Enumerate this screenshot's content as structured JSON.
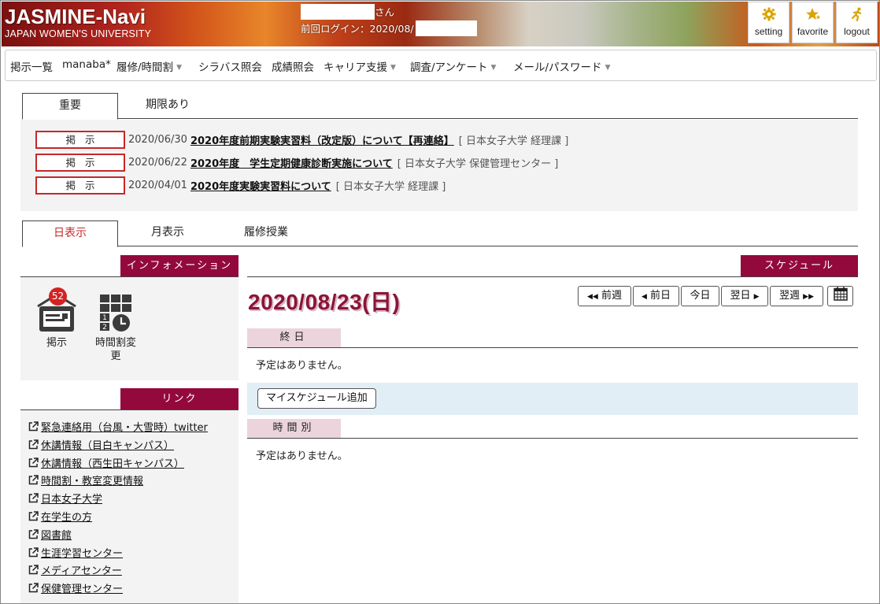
{
  "header": {
    "logo_title": "JASMINE-Navi",
    "logo_subtitle": "JAPAN WOMEN'S UNIVERSITY",
    "user_suffix": "さん",
    "last_login_label": "前回ログイン：2020/08/",
    "buttons": [
      {
        "label": "setting",
        "icon": "gear-icon"
      },
      {
        "label": "favorite",
        "icon": "star-icon"
      },
      {
        "label": "logout",
        "icon": "runner-icon"
      }
    ]
  },
  "nav": {
    "items": [
      {
        "label": "掲示一覧",
        "dropdown": false
      },
      {
        "label": "manaba*",
        "dropdown": false
      },
      {
        "label": "履修/時間割",
        "dropdown": true
      },
      {
        "label": "シラバス照会",
        "dropdown": false
      },
      {
        "label": "成績照会",
        "dropdown": false
      },
      {
        "label": "キャリア支援",
        "dropdown": true
      },
      {
        "label": "調査/アンケート",
        "dropdown": true
      },
      {
        "label": "メール/パスワード",
        "dropdown": true
      }
    ]
  },
  "notice_tabs": [
    {
      "label": "重要",
      "active": true
    },
    {
      "label": "期限あり",
      "active": false
    }
  ],
  "notices": [
    {
      "badge": "掲示",
      "date": "2020/06/30",
      "title": "2020年度前期実験実習料（改定版）について【再連絡】",
      "source": "[ 日本女子大学 経理課 ]"
    },
    {
      "badge": "掲示",
      "date": "2020/06/22",
      "title": "2020年度　学生定期健康診断実施について",
      "source": "[ 日本女子大学 保健管理センター ]"
    },
    {
      "badge": "掲示",
      "date": "2020/04/01",
      "title": "2020年度実験実習料について",
      "source": "[ 日本女子大学 経理課 ]"
    }
  ],
  "view_tabs": [
    {
      "label": "日表示",
      "active": true
    },
    {
      "label": "月表示",
      "active": false
    },
    {
      "label": "履修授業",
      "active": false
    }
  ],
  "info": {
    "header": "インフォメーション",
    "tiles": [
      {
        "label": "掲示",
        "icon": "bulletin-board-icon",
        "count": "52"
      },
      {
        "label": "時間割変更",
        "icon": "timetable-change-icon"
      }
    ]
  },
  "links": {
    "header": "リンク",
    "items": [
      "緊急連絡用（台風・大雪時）twitter",
      "休講情報（目白キャンパス）",
      "休講情報（西生田キャンパス）",
      "時間割・教室変更情報",
      "日本女子大学",
      "在学生の方",
      "図書館",
      "生涯学習センター",
      "メディアセンター",
      "保健管理センター"
    ]
  },
  "schedule": {
    "header": "スケジュール",
    "date": "2020/08/23(日)",
    "nav_buttons": {
      "prev_week": "前週",
      "prev_day": "前日",
      "today": "今日",
      "next_day": "翌日",
      "next_week": "翌週"
    },
    "allday_label": "終日",
    "allday_empty": "予定はありません。",
    "add_button": "マイスケジュール追加",
    "timed_label": "時間別",
    "timed_empty": "予定はありません。"
  },
  "colors": {
    "accent": "#93093b",
    "badge_border": "#c62828",
    "count_badge": "#d32222",
    "date_title": "#8a1538",
    "sub_label_bg": "#ecd4dc",
    "add_bar_bg": "#e1eef5",
    "icon_gold": "#d9a400"
  }
}
